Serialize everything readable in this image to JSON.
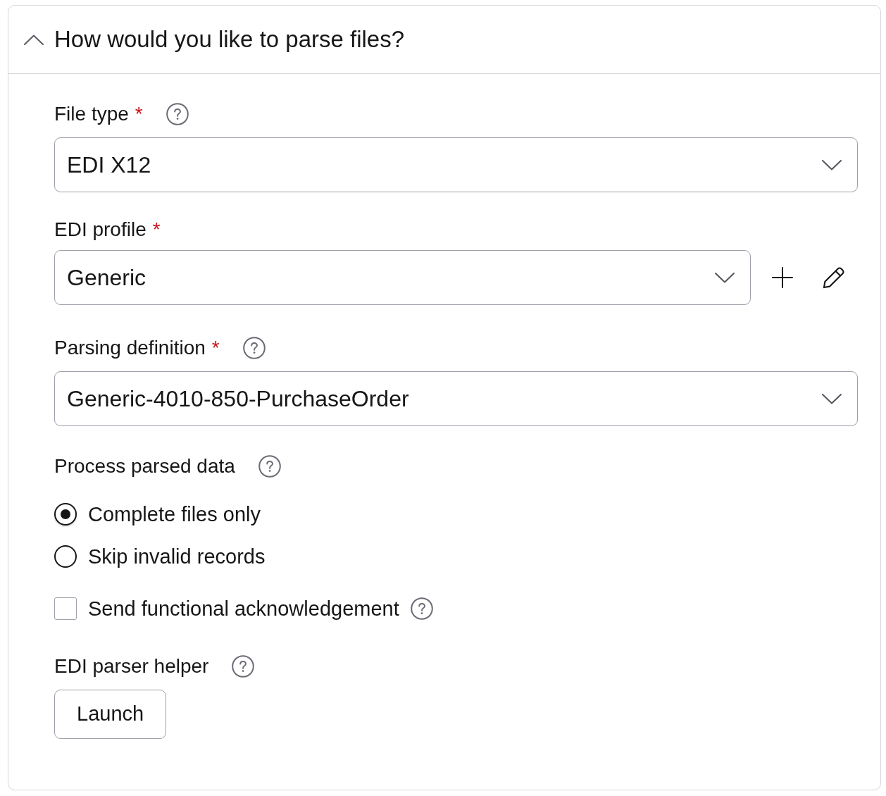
{
  "section": {
    "title": "How would you like to parse files?",
    "expanded": true
  },
  "fields": [
    {
      "kind": "select",
      "label": "File type",
      "required_mark": "*",
      "help": true,
      "value": "EDI X12"
    },
    {
      "kind": "select",
      "label": "EDI profile",
      "required_mark": "*",
      "help": false,
      "value": "Generic",
      "actions": [
        {
          "kind": "add"
        },
        {
          "kind": "edit"
        }
      ]
    },
    {
      "kind": "select",
      "label": "Parsing definition",
      "required_mark": "*",
      "help": true,
      "value": "Generic-4010-850-PurchaseOrder"
    },
    {
      "kind": "radio_group",
      "label": "Process parsed data",
      "help": true,
      "options": [
        {
          "label": "Complete files only",
          "selected": true
        },
        {
          "label": "Skip invalid records",
          "selected": false
        }
      ]
    },
    {
      "kind": "checkbox",
      "label": "Send functional acknowledgement",
      "checked": false,
      "help": true
    },
    {
      "kind": "launcher",
      "label": "EDI parser helper",
      "help": true,
      "button": "Launch"
    }
  ]
}
